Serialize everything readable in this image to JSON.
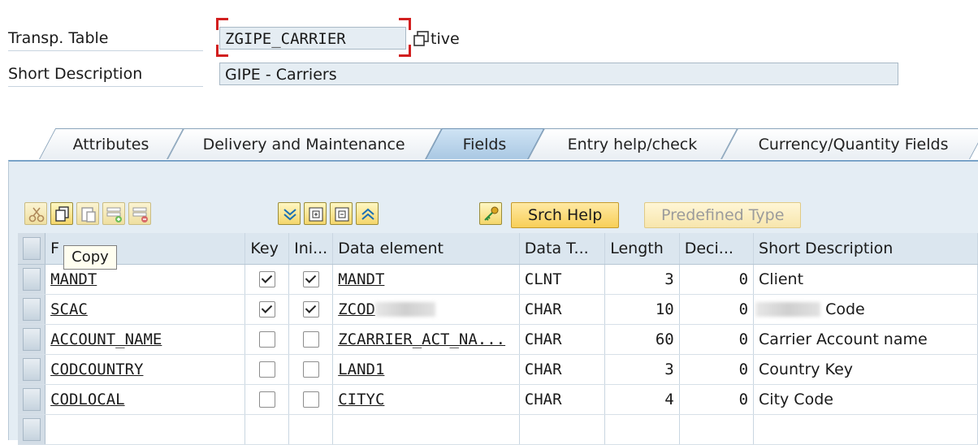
{
  "header": {
    "table_label": "Transp. Table",
    "table_value": "ZGIPE_CARRIER",
    "status_text": "tive",
    "desc_label": "Short Description",
    "desc_value": "GIPE - Carriers"
  },
  "tabs": [
    {
      "label": "Attributes"
    },
    {
      "label": "Delivery and Maintenance"
    },
    {
      "label": "Fields"
    },
    {
      "label": "Entry help/check"
    },
    {
      "label": "Currency/Quantity Fields"
    }
  ],
  "toolbar": {
    "icons": [
      "cut-icon",
      "copy-icon",
      "paste-icon",
      "insert-row-icon",
      "delete-row-icon",
      "expand-all-icon",
      "expand-node-icon",
      "collapse-node-icon",
      "collapse-all-icon",
      "key-icon"
    ],
    "srch_help": "Srch Help",
    "predefined_type": "Predefined Type",
    "tooltip": "Copy"
  },
  "table": {
    "headers": {
      "field": "F",
      "key": "Key",
      "ini": "Ini...",
      "data_element": "Data element",
      "data_type": "Data T...",
      "length": "Length",
      "deci": "Deci...",
      "short_desc": "Short Description"
    },
    "rows": [
      {
        "field": "MANDT",
        "key": true,
        "ini": true,
        "data_element": "MANDT",
        "data_type": "CLNT",
        "length": "3",
        "deci": "0",
        "short_desc": "Client"
      },
      {
        "field": "SCAC",
        "key": true,
        "ini": true,
        "data_element": "ZCOD",
        "data_type": "CHAR",
        "length": "10",
        "deci": "0",
        "short_desc": "Code"
      },
      {
        "field": "ACCOUNT_NAME",
        "key": false,
        "ini": false,
        "data_element": "ZCARRIER_ACT_NA...",
        "data_type": "CHAR",
        "length": "60",
        "deci": "0",
        "short_desc": "Carrier Account name"
      },
      {
        "field": "CODCOUNTRY",
        "key": false,
        "ini": false,
        "data_element": "LAND1",
        "data_type": "CHAR",
        "length": "3",
        "deci": "0",
        "short_desc": "Country Key"
      },
      {
        "field": "CODLOCAL",
        "key": false,
        "ini": false,
        "data_element": "CITYC",
        "data_type": "CHAR",
        "length": "4",
        "deci": "0",
        "short_desc": "City Code"
      }
    ]
  }
}
